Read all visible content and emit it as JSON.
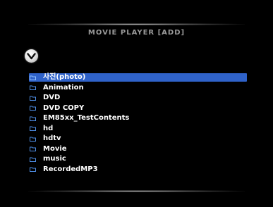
{
  "header": {
    "title": "MOVIE PLAYER [ADD]"
  },
  "nav": {
    "back_icon": "chevron-down-circle-icon"
  },
  "folders": [
    {
      "label": "사진(photo)",
      "selected": true,
      "icon": "folder-icon"
    },
    {
      "label": "Animation",
      "selected": false,
      "icon": "folder-icon"
    },
    {
      "label": "DVD",
      "selected": false,
      "icon": "folder-icon"
    },
    {
      "label": "DVD COPY",
      "selected": false,
      "icon": "folder-icon"
    },
    {
      "label": "EM85xx_TestContents",
      "selected": false,
      "icon": "folder-icon"
    },
    {
      "label": "hd",
      "selected": false,
      "icon": "folder-icon"
    },
    {
      "label": "hdtv",
      "selected": false,
      "icon": "folder-icon"
    },
    {
      "label": "Movie",
      "selected": false,
      "icon": "folder-icon"
    },
    {
      "label": "music",
      "selected": false,
      "icon": "folder-icon"
    },
    {
      "label": "RecordedMP3",
      "selected": false,
      "icon": "folder-icon"
    }
  ],
  "colors": {
    "background": "#000000",
    "selection": "#2f62c9",
    "folder_icon": "#4f8fe8",
    "title_text": "#9a9a9a"
  }
}
